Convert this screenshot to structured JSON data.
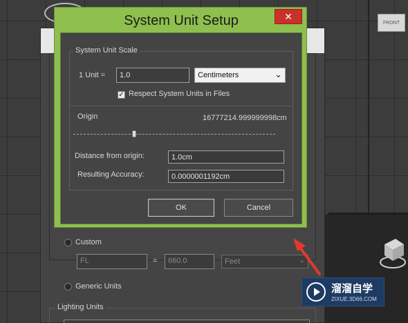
{
  "colors": {
    "dialog_frame": "#8fbf4f",
    "close_button": "#c9302c",
    "annotation_arrow": "#e03a2c",
    "dialog_body": "#444444",
    "watermark_bg": "#1e3b63"
  },
  "viewport": {
    "viewcube_label": "FRONT"
  },
  "dialog": {
    "title": "System Unit Setup",
    "close_label": "✕",
    "unit_scale": {
      "caption": "System Unit Scale",
      "unit_label": "1 Unit =",
      "unit_value": "1.0",
      "unit_type": "Centimeters",
      "respect_label": "Respect System Units in Files",
      "respect_checked": "✓"
    },
    "origin": {
      "label": "Origin",
      "value": "16777214.999999998cm",
      "slider_position": 0.3,
      "distance_label": "Distance from origin:",
      "distance_value": "1.0cm",
      "accuracy_label": "Resulting Accuracy:",
      "accuracy_value": "0.0000001192cm"
    },
    "ok_label": "OK",
    "cancel_label": "Cancel"
  },
  "background_dialog": {
    "custom_label": "Custom",
    "custom_name": "FL",
    "equals": "=",
    "custom_value": "660.0",
    "custom_unit": "Feet",
    "generic_label": "Generic Units",
    "lighting_label": "Lighting Units"
  },
  "watermark": {
    "title": "溜溜自学",
    "url": "ZIXUE.3D66.COM"
  }
}
